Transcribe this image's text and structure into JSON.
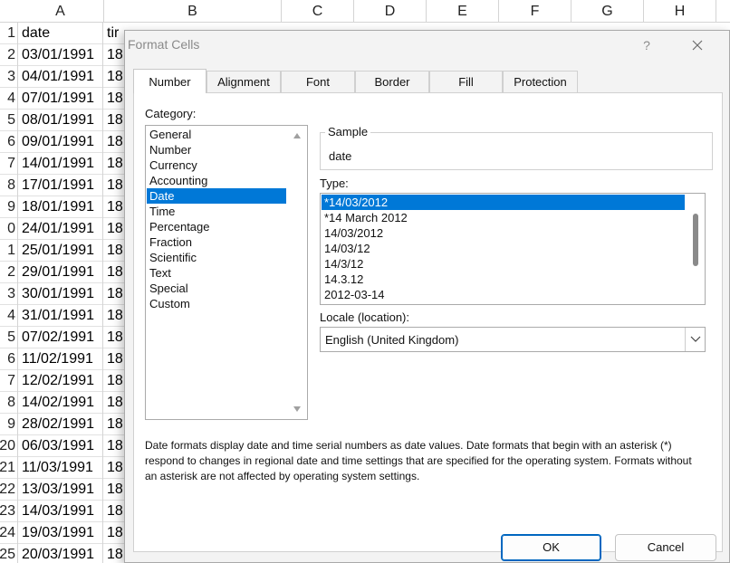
{
  "sheet": {
    "columns": [
      "A",
      "B",
      "C",
      "D",
      "E",
      "F",
      "G",
      "H"
    ],
    "header_a": "date",
    "header_b": "tir",
    "rows": [
      {
        "num": "1",
        "a": "date",
        "b": "tir"
      },
      {
        "num": "2",
        "a": "03/01/1991",
        "b": "18"
      },
      {
        "num": "3",
        "a": "04/01/1991",
        "b": "18"
      },
      {
        "num": "4",
        "a": "07/01/1991",
        "b": "18"
      },
      {
        "num": "5",
        "a": "08/01/1991",
        "b": "18"
      },
      {
        "num": "6",
        "a": "09/01/1991",
        "b": "18"
      },
      {
        "num": "7",
        "a": "14/01/1991",
        "b": "18"
      },
      {
        "num": "8",
        "a": "17/01/1991",
        "b": "18"
      },
      {
        "num": "9",
        "a": "18/01/1991",
        "b": "18"
      },
      {
        "num": "0",
        "a": "24/01/1991",
        "b": "18"
      },
      {
        "num": "1",
        "a": "25/01/1991",
        "b": "18"
      },
      {
        "num": "2",
        "a": "29/01/1991",
        "b": "18"
      },
      {
        "num": "3",
        "a": "30/01/1991",
        "b": "18"
      },
      {
        "num": "4",
        "a": "31/01/1991",
        "b": "18"
      },
      {
        "num": "5",
        "a": "07/02/1991",
        "b": "18"
      },
      {
        "num": "6",
        "a": "11/02/1991",
        "b": "18"
      },
      {
        "num": "7",
        "a": "12/02/1991",
        "b": "18"
      },
      {
        "num": "8",
        "a": "14/02/1991",
        "b": "18"
      },
      {
        "num": "9",
        "a": "28/02/1991",
        "b": "18"
      },
      {
        "num": "20",
        "a": "06/03/1991",
        "b": "18"
      },
      {
        "num": "21",
        "a": "11/03/1991",
        "b": "18"
      },
      {
        "num": "22",
        "a": "13/03/1991",
        "b": "18"
      },
      {
        "num": "23",
        "a": "14/03/1991",
        "b": "18"
      },
      {
        "num": "24",
        "a": "19/03/1991",
        "b": "18"
      },
      {
        "num": "25",
        "a": "20/03/1991",
        "b": "18"
      }
    ]
  },
  "dialog": {
    "title": "Format Cells",
    "help": "?",
    "tabs": [
      "Number",
      "Alignment",
      "Font",
      "Border",
      "Fill",
      "Protection"
    ],
    "active_tab": "Number",
    "category_label": "Category:",
    "categories": [
      "General",
      "Number",
      "Currency",
      "Accounting",
      "Date",
      "Time",
      "Percentage",
      "Fraction",
      "Scientific",
      "Text",
      "Special",
      "Custom"
    ],
    "selected_category": "Date",
    "sample_label": "Sample",
    "sample_value": "date",
    "type_label": "Type:",
    "types": [
      "*14/03/2012",
      "*14 March 2012",
      "14/03/2012",
      "14/03/12",
      "14/3/12",
      "14.3.12",
      "2012-03-14"
    ],
    "selected_type": "*14/03/2012",
    "locale_label": "Locale (location):",
    "locale_value": "English (United Kingdom)",
    "description": "Date formats display date and time serial numbers as date values.  Date formats that begin with an asterisk (*) respond to changes in regional date and time settings that are specified for the operating system. Formats without an asterisk are not affected by operating system settings.",
    "ok_label": "OK",
    "cancel_label": "Cancel"
  },
  "colors": {
    "selection": "#0078d7",
    "ok_border": "#0067c0"
  }
}
